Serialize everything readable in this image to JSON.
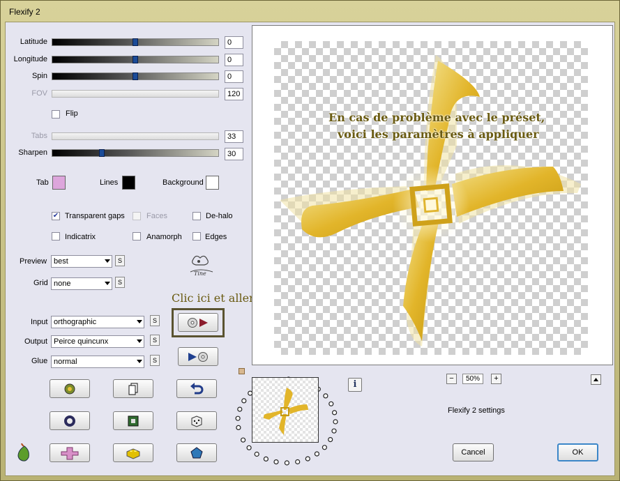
{
  "window": {
    "title": "Flexify 2"
  },
  "controls": {
    "latitude": {
      "label": "Latitude",
      "value": "0",
      "position": 0.5
    },
    "longitude": {
      "label": "Longitude",
      "value": "0",
      "position": 0.5
    },
    "spin": {
      "label": "Spin",
      "value": "0",
      "position": 0.5
    },
    "fov": {
      "label": "FOV",
      "value": "120"
    },
    "flip": {
      "label": "Flip",
      "checked": false
    },
    "tabs": {
      "label": "Tabs",
      "value": "33"
    },
    "sharpen": {
      "label": "Sharpen",
      "value": "30",
      "position": 0.3
    }
  },
  "colors": {
    "tab": {
      "label": "Tab",
      "color": "#dda6dc"
    },
    "lines": {
      "label": "Lines",
      "color": "#000000"
    },
    "background": {
      "label": "Background",
      "color": "#ffffff"
    }
  },
  "options": {
    "transparent_gaps": {
      "label": "Transparent gaps",
      "checked": true
    },
    "faces": {
      "label": "Faces",
      "checked": false
    },
    "de_halo": {
      "label": "De-halo",
      "checked": false
    },
    "indicatrix": {
      "label": "Indicatrix",
      "checked": false
    },
    "anamorph": {
      "label": "Anamorph",
      "checked": false
    },
    "edges": {
      "label": "Edges",
      "checked": false
    }
  },
  "selects": {
    "preview": {
      "label": "Preview",
      "value": "best"
    },
    "grid": {
      "label": "Grid",
      "value": "none"
    },
    "input": {
      "label": "Input",
      "value": "orthographic"
    },
    "output": {
      "label": "Output",
      "value": "Peirce quincunx"
    },
    "glue": {
      "label": "Glue",
      "value": "normal"
    }
  },
  "s_button_label": "S",
  "annotations": {
    "caption_preset": "Clic ici et aller chercher le preset",
    "preview_line1": "En cas de problème avec le préset,",
    "preview_line2": "voici les paramètres à appliquer"
  },
  "zoom": {
    "value": "50%",
    "minus": "−",
    "plus": "+"
  },
  "info_icon": "i",
  "settings_label": "Flexify 2 settings",
  "buttons": {
    "cancel": "Cancel",
    "ok": "OK"
  },
  "accent_gold": "#e2b52a"
}
